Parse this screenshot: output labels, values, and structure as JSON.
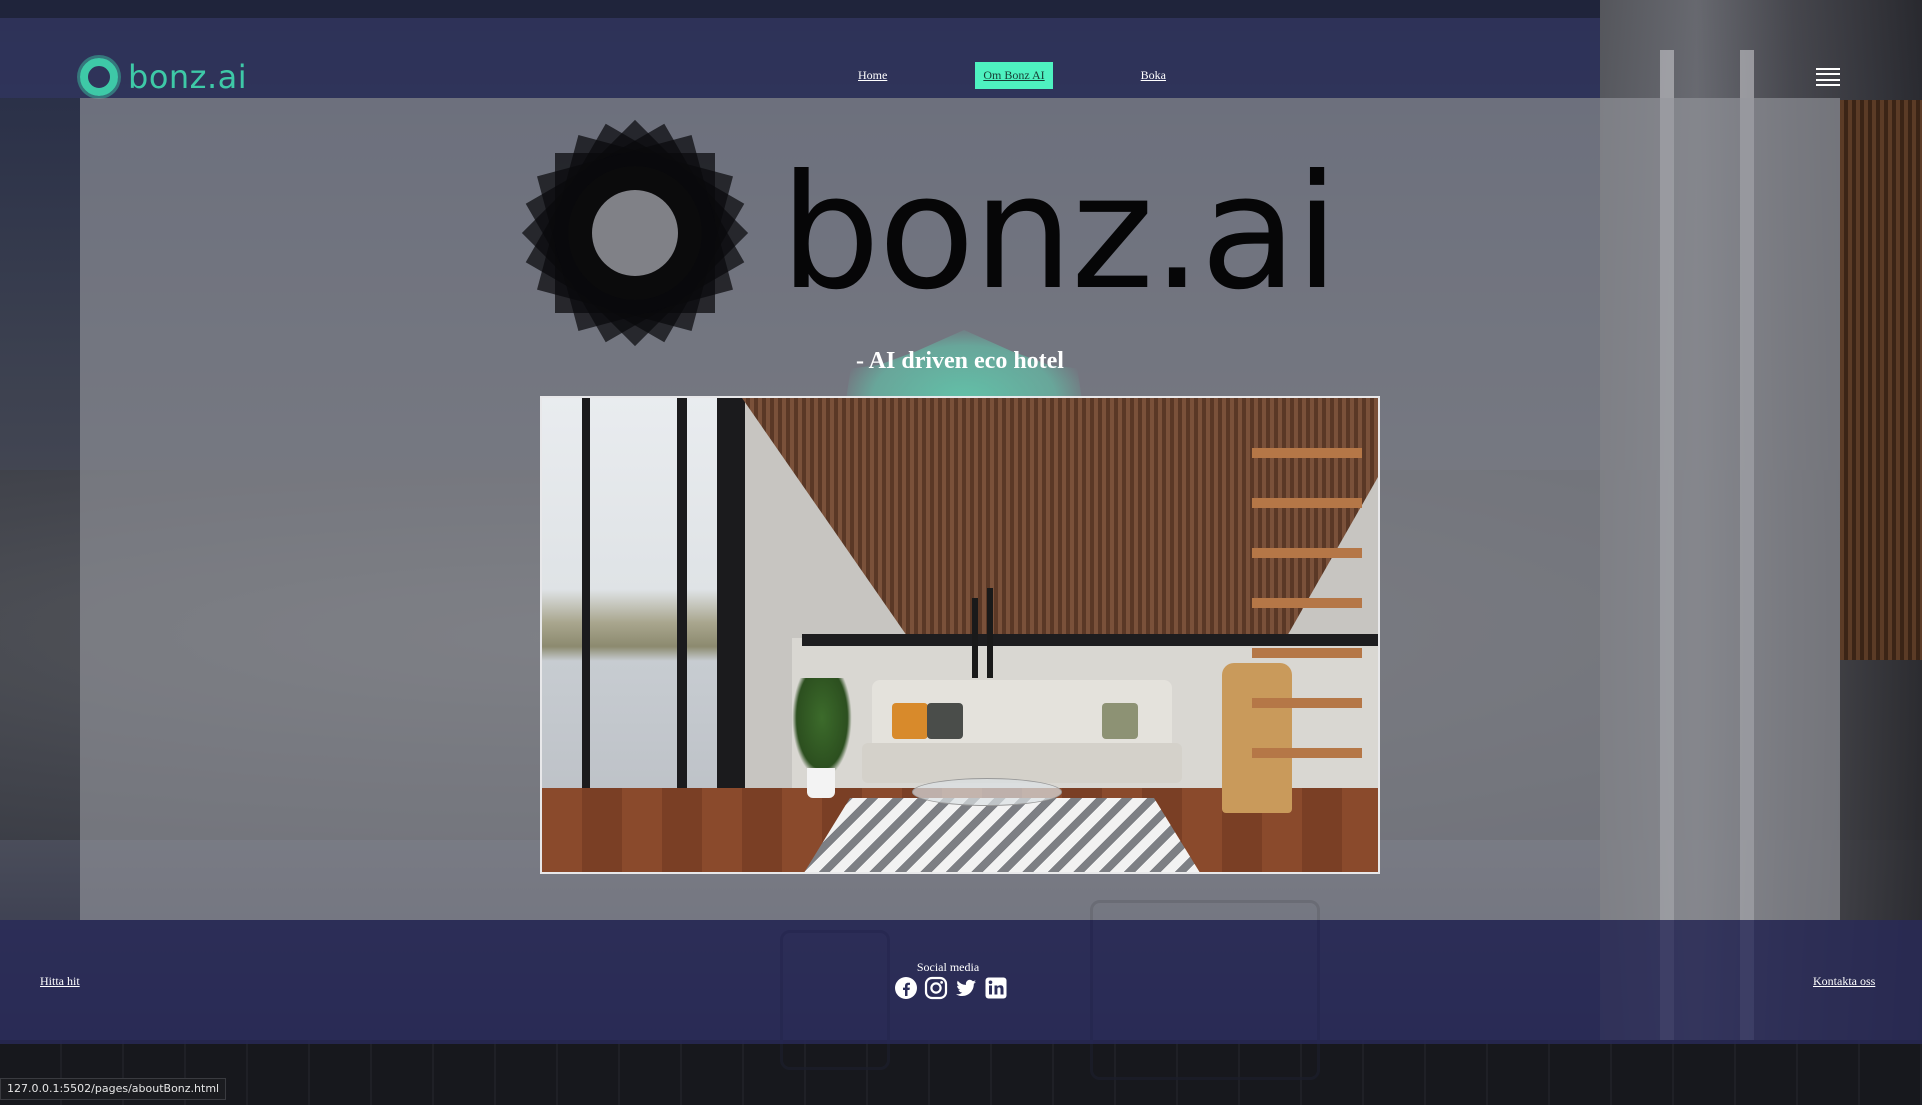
{
  "brand": {
    "name": "bonz.ai",
    "accent_color": "#3ec9a7"
  },
  "nav": {
    "items": [
      {
        "label": "Home"
      },
      {
        "label": "Om Bonz AI",
        "active": true
      },
      {
        "label": "Boka"
      }
    ],
    "active_bg": "#4ef2c0",
    "menu_icon": "hamburger-menu-icon"
  },
  "hero": {
    "wordmark": "bonz.ai",
    "tagline": "- AI driven eco hotel",
    "logo_icon": "sun-ring-logo-icon"
  },
  "footer": {
    "left_link": "Hitta hit",
    "social_label": "Social media",
    "social_icons": [
      "facebook-icon",
      "instagram-icon",
      "twitter-icon",
      "linkedin-icon"
    ],
    "right_link": "Kontakta oss"
  },
  "status_bar": {
    "url": "127.0.0.1:5502/pages/aboutBonz.html"
  }
}
